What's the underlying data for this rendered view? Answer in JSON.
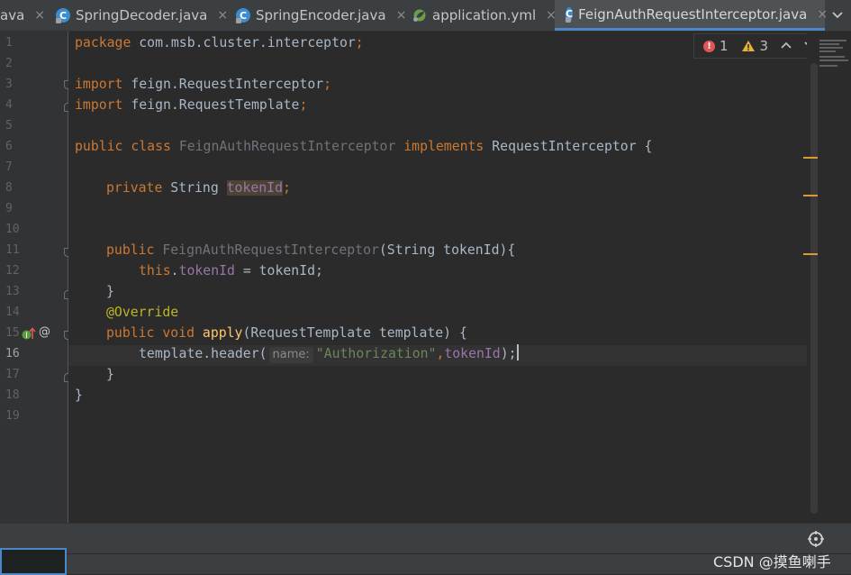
{
  "tabs": [
    {
      "label": "ava",
      "icon": "none",
      "active": false
    },
    {
      "label": "SpringDecoder.java",
      "icon": "java-class-icon",
      "active": false
    },
    {
      "label": "SpringEncoder.java",
      "icon": "java-class-icon",
      "active": false
    },
    {
      "label": "application.yml",
      "icon": "spring-leaf-icon",
      "active": false
    },
    {
      "label": "FeignAuthRequestInterceptor.java",
      "icon": "java-class-icon",
      "active": true
    }
  ],
  "tab_icon_letter": "C",
  "close_glyph": "×",
  "line_numbers": [
    "1",
    "2",
    "3",
    "4",
    "5",
    "6",
    "7",
    "8",
    "9",
    "10",
    "11",
    "12",
    "13",
    "14",
    "15",
    "16",
    "17",
    "18",
    "19"
  ],
  "current_line": "16",
  "gutter_markers": {
    "implementing": "↑",
    "override": "@",
    "implementing_badge": "I"
  },
  "inspections": {
    "errors": "1",
    "warnings": "3",
    "error_glyph": "!"
  },
  "code": {
    "l1": {
      "kw": "package",
      "rest": " com.msb.cluster.interceptor",
      "semi": ";"
    },
    "l3": {
      "kw": "import",
      "rest": " feign.RequestInterceptor",
      "semi": ";"
    },
    "l4": {
      "kw": "import",
      "rest": " feign.RequestTemplate",
      "semi": ";"
    },
    "l6": {
      "kw1": "public class ",
      "name": "FeignAuthRequestInterceptor",
      "kw2": " implements ",
      "iface": "RequestInterceptor {"
    },
    "l8": {
      "kw": "private ",
      "type": "String ",
      "field": "tokenId",
      "semi": ";"
    },
    "l11": {
      "kw": "public ",
      "name": "FeignAuthRequestInterceptor",
      "params": "(String tokenId){"
    },
    "l12": {
      "kw": "this",
      "dot": ".",
      "field": "tokenId",
      "rest": " = tokenId;"
    },
    "l13": "}",
    "l14": "@Override",
    "l15": {
      "kw": "public void ",
      "meth": "apply",
      "params": "(RequestTemplate template) {"
    },
    "l16": {
      "call": "template.header(",
      "hint": "name:",
      "str": "\"Authorization\"",
      "comma": ",",
      "arg": "tokenId",
      "end": ");"
    },
    "l17": "}",
    "l18": "}"
  },
  "watermark": "CSDN @摸鱼喇手",
  "colors": {
    "accent": "#4a88c7",
    "error": "#e05555",
    "warning": "#e8b13a"
  }
}
